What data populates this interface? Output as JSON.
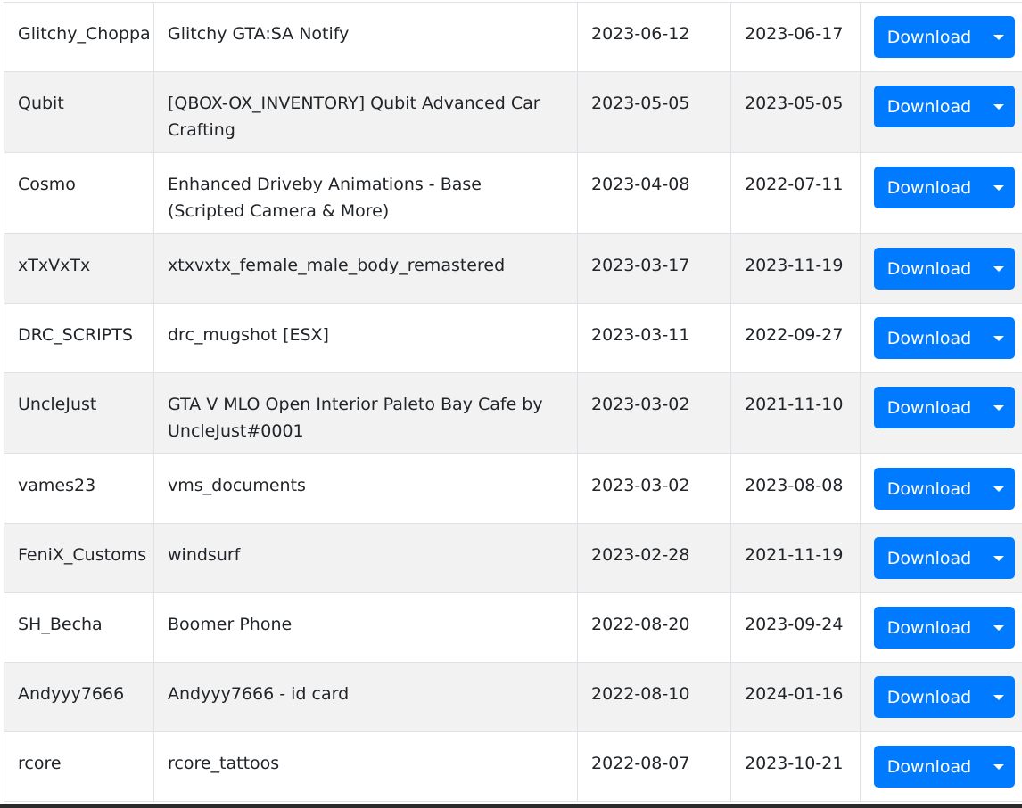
{
  "table": {
    "rows": [
      {
        "author": "Glitchy_Choppa",
        "name": "Glitchy GTA:SA Notify",
        "date1": "2023-06-12",
        "date2": "2023-06-17",
        "button": "Download"
      },
      {
        "author": "Qubit",
        "name": "[QBOX-OX_INVENTORY] Qubit Advanced Car Crafting",
        "date1": "2023-05-05",
        "date2": "2023-05-05",
        "button": "Download"
      },
      {
        "author": "Cosmo",
        "name": "Enhanced Driveby Animations - Base (Scripted Camera & More)",
        "date1": "2023-04-08",
        "date2": "2022-07-11",
        "button": "Download"
      },
      {
        "author": "xTxVxTx",
        "name": "xtxvxtx_female_male_body_remastered",
        "date1": "2023-03-17",
        "date2": "2023-11-19",
        "button": "Download"
      },
      {
        "author": "DRC_SCRIPTS",
        "name": "drc_mugshot [ESX]",
        "date1": "2023-03-11",
        "date2": "2022-09-27",
        "button": "Download"
      },
      {
        "author": "UncleJust",
        "name": "GTA V MLO Open Interior Paleto Bay Cafe by UncleJust#0001",
        "date1": "2023-03-02",
        "date2": "2021-11-10",
        "button": "Download"
      },
      {
        "author": "vames23",
        "name": "vms_documents",
        "date1": "2023-03-02",
        "date2": "2023-08-08",
        "button": "Download"
      },
      {
        "author": "FeniX_Customs",
        "name": "windsurf",
        "date1": "2023-02-28",
        "date2": "2021-11-19",
        "button": "Download"
      },
      {
        "author": "SH_Becha",
        "name": "Boomer Phone",
        "date1": "2022-08-20",
        "date2": "2023-09-24",
        "button": "Download"
      },
      {
        "author": "Andyyy7666",
        "name": "Andyyy7666 - id card",
        "date1": "2022-08-10",
        "date2": "2024-01-16",
        "button": "Download"
      },
      {
        "author": "rcore",
        "name": "rcore_tattoos",
        "date1": "2022-08-07",
        "date2": "2023-10-21",
        "button": "Download"
      }
    ]
  },
  "icons": {
    "dropdown_toggle": "caret-down-icon"
  },
  "colors": {
    "button": "#007bff",
    "stripe": "#f2f2f2",
    "border": "#dee2e6"
  }
}
